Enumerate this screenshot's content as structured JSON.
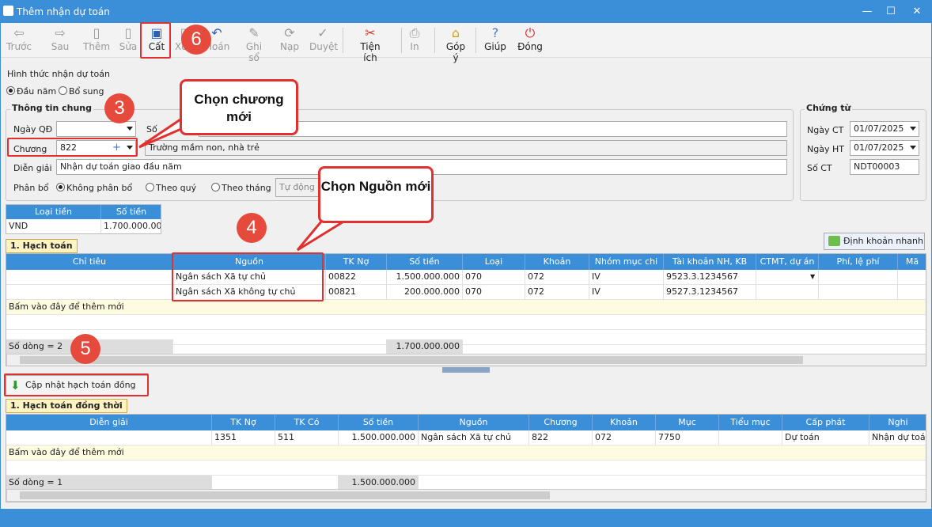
{
  "window": {
    "title": "Thêm nhận dự toán",
    "minimize": "—",
    "maximize": "☐",
    "close": "✕"
  },
  "toolbar": {
    "back": "Trước",
    "next": "Sau",
    "add": "Thêm",
    "edit": "Sửa",
    "save": "Cất",
    "delete": "Xóa",
    "posting": "Hoán",
    "record": "Ghi sổ",
    "reload": "Nạp",
    "approve": "Duyệt",
    "utilities": "Tiện ích",
    "print": "In",
    "feedback": "Góp ý",
    "help": "Giúp",
    "close": "Đóng"
  },
  "form": {
    "mode_label": "Hình thức nhận dự toán",
    "mode_start": "Đầu năm",
    "mode_extra": "Bổ sung",
    "general_title": "Thông tin chung",
    "date_qd_label": "Ngày QĐ",
    "date_qd_value": "",
    "so_label": "Số",
    "chapter_label": "Chương",
    "chapter_value": "822",
    "chapter_name": "Trường mầm non, nhà trẻ",
    "desc_label": "Diễn giải",
    "desc_value": "Nhận dự toán giao đầu năm",
    "alloc_label": "Phân bổ",
    "alloc_none": "Không phân bổ",
    "alloc_quarter": "Theo quý",
    "alloc_month": "Theo tháng",
    "auto_btn": "Tự động p",
    "voucher_title": "Chứng từ",
    "date_ct_label": "Ngày CT",
    "date_ct_value": "01/07/2025",
    "date_ht_label": "Ngày HT",
    "date_ht_value": "01/07/2025",
    "so_ct_label": "Số CT",
    "so_ct_value": "NDT00003"
  },
  "currency": {
    "headers": [
      "Loại tiền",
      "Số tiền"
    ],
    "row": [
      "VND",
      "1.700.000.000"
    ]
  },
  "quick_btn": "Định khoản nhanh",
  "hachtoan": {
    "tab": "1. Hạch toán",
    "headers": [
      "Chỉ tiêu",
      "Nguồn",
      "TK Nợ",
      "Số tiền",
      "Loại",
      "Khoản",
      "Nhóm mục chi",
      "Tài khoản NH, KB",
      "CTMT, dự án",
      "Phí, lệ phí",
      "Mã"
    ],
    "rows": [
      [
        "",
        "Ngân sách Xã tự chủ",
        "00822",
        "1.500.000.000",
        "070",
        "072",
        "IV",
        "9523.3.1234567",
        "",
        ""
      ],
      [
        "",
        "Ngân sách Xã không tự chủ",
        "00821",
        "200.000.000",
        "070",
        "072",
        "IV",
        "9527.3.1234567",
        "",
        ""
      ]
    ],
    "add_row": "Bấm vào đây để thêm mới",
    "count": "Số dòng = 2",
    "total": "1.700.000.000"
  },
  "update_btn": "Cập nhật hạch toán đồng thời",
  "dongthoi": {
    "tab": "1. Hạch toán đồng thời",
    "headers": [
      "Diễn giải",
      "TK Nợ",
      "TK Có",
      "Số tiền",
      "Nguồn",
      "Chương",
      "Khoản",
      "Mục",
      "Tiểu mục",
      "Cấp phát",
      "Nghi"
    ],
    "rows": [
      [
        "",
        "1351",
        "511",
        "1.500.000.000",
        "Ngân sách Xã tự chủ",
        "822",
        "072",
        "7750",
        "",
        "Dự toán",
        "Nhận dự toán"
      ]
    ],
    "add_row": "Bấm vào đây để thêm mới",
    "count": "Số dòng = 1",
    "total": "1.500.000.000"
  },
  "annotations": {
    "b3": "3",
    "b4": "4",
    "b5": "5",
    "b6": "6",
    "callout1": "Chọn chương mới",
    "callout2": "Chọn Nguồn mới"
  }
}
